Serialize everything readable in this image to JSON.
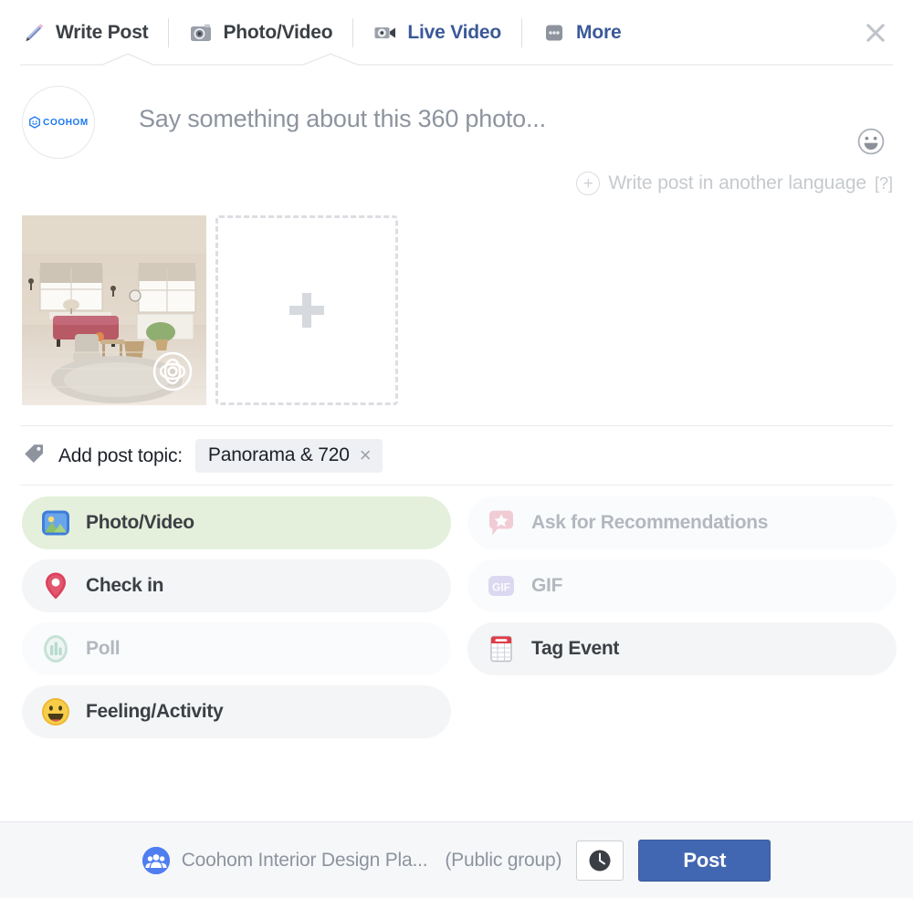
{
  "tabs": [
    {
      "label": "Write Post",
      "icon": "pencil-icon",
      "state": "active"
    },
    {
      "label": "Photo/Video",
      "icon": "camera-icon",
      "state": "active"
    },
    {
      "label": "Live Video",
      "icon": "live-video-icon",
      "state": "link"
    },
    {
      "label": "More",
      "icon": "ellipsis-icon",
      "state": "link"
    }
  ],
  "close": {
    "icon": "close-icon"
  },
  "composer": {
    "avatar_logo_text": "COOHOM",
    "placeholder": "Say something about this 360 photo...",
    "value": "",
    "emoji_icon": "emoji-smiley-icon"
  },
  "language_row": {
    "plus_icon": "plus-circle-icon",
    "label": "Write post in another language",
    "help": "[?]"
  },
  "attachments": {
    "photo": {
      "badge_icon": "photo-360-badge-icon",
      "alt": "interior living room 360 photo"
    },
    "add_label": "+"
  },
  "topic": {
    "tag_icon": "tag-icon",
    "label": "Add post topic:",
    "chip": "Panorama & 720",
    "chip_remove": "×"
  },
  "options": [
    {
      "label": "Photo/Video",
      "icon": "photo-video-icon",
      "state": "selected"
    },
    {
      "label": "Check in",
      "icon": "location-pin-icon",
      "state": "enabled"
    },
    {
      "label": "Poll",
      "icon": "poll-icon",
      "state": "disabled"
    },
    {
      "label": "Feeling/Activity",
      "icon": "feeling-smiley-icon",
      "state": "enabled"
    },
    {
      "label": "Ask for Recommendations",
      "icon": "recommendation-icon",
      "state": "disabled"
    },
    {
      "label": "GIF",
      "icon": "gif-icon",
      "state": "disabled"
    },
    {
      "label": "Tag Event",
      "icon": "calendar-icon",
      "state": "enabled"
    }
  ],
  "footer": {
    "group_icon": "group-avatar-icon",
    "group_name": "Coohom Interior Design Pla...",
    "privacy": "(Public group)",
    "schedule_icon": "clock-icon",
    "post_label": "Post"
  },
  "colors": {
    "link_blue": "#3b5998",
    "post_blue": "#4267b2",
    "selected_green": "#e4f0db",
    "muted_gray": "#8d949e",
    "chip_gray": "#eef0f3"
  }
}
